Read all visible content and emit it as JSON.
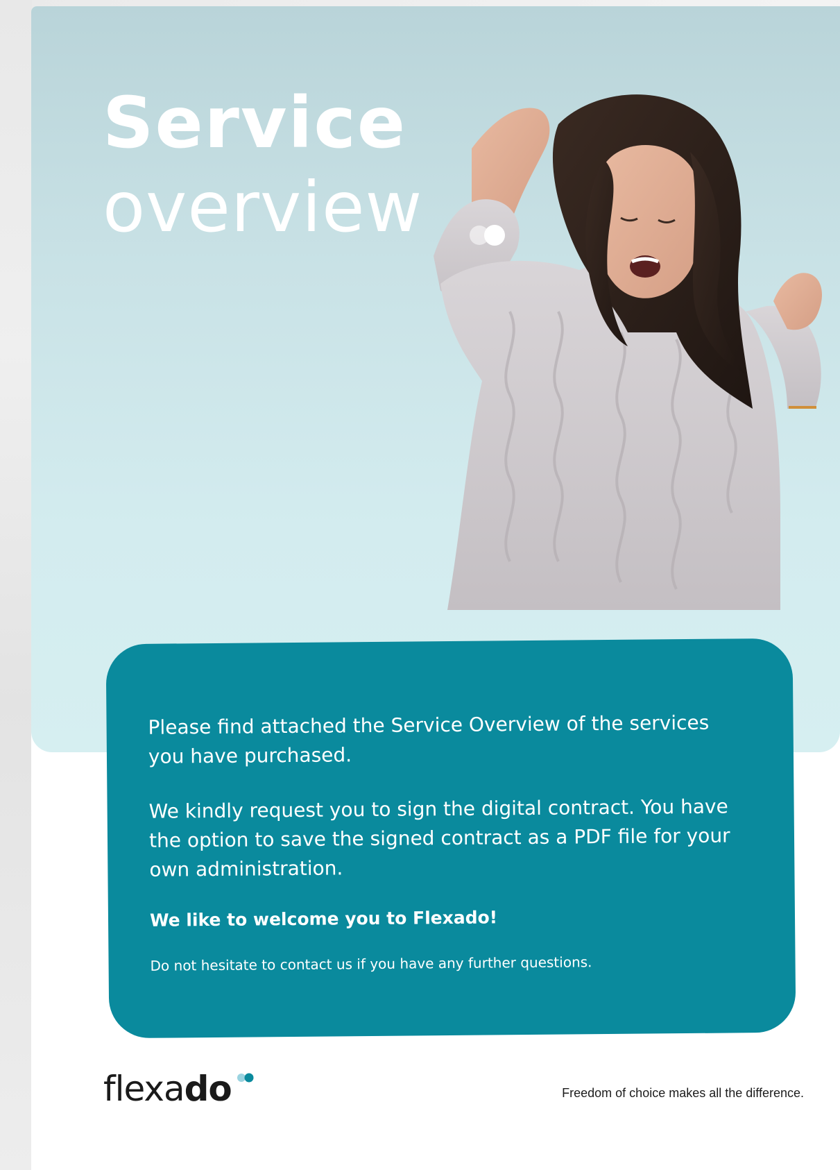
{
  "title": {
    "line1": "Service",
    "line2": "overview"
  },
  "info": {
    "paragraph1": "Please find attached the Service Overview of the services you have purchased.",
    "paragraph2": "We kindly request you to sign the digital contract. You have the option to save the signed contract as a PDF file for your own administration.",
    "welcome": "We like to welcome you to Flexado!",
    "contact": "Do not hesitate to contact us if you have any further questions."
  },
  "brand": {
    "logo_light": "flexa",
    "logo_bold": "do",
    "slogan": "Freedom of choice makes all the difference.",
    "accent_color": "#0a8a9d",
    "dot_color_light": "#9ad3e0",
    "dot_color_dark": "#0a8a9d"
  }
}
